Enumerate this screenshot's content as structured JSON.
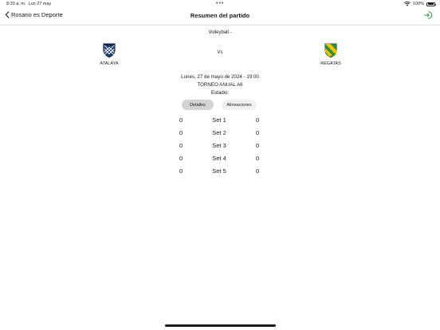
{
  "status_bar": {
    "time": "8:20 a. m.",
    "date": "Lun 27 may",
    "battery": "100%"
  },
  "nav": {
    "back_label": "Rosario es Deporte",
    "title": "Resumen del partido"
  },
  "match": {
    "sport": "Volleyball -",
    "vs": "Vs",
    "home_team": "ATALAYA",
    "away_team": "REGATAS",
    "datetime": "Lunes, 27 de mayo de 2024 - 19:00",
    "tournament": "TORNEO ANUAL A6",
    "stadium": "Estadio:"
  },
  "tabs": {
    "details": "Detalles",
    "lineups": "Alineaciones"
  },
  "sets": [
    {
      "label": "Set 1",
      "home": "0",
      "away": "0"
    },
    {
      "label": "Set 2",
      "home": "0",
      "away": "0"
    },
    {
      "label": "Set 3",
      "home": "0",
      "away": "0"
    },
    {
      "label": "Set 4",
      "home": "0",
      "away": "0"
    },
    {
      "label": "Set 5",
      "home": "0",
      "away": "0"
    }
  ],
  "colors": {
    "accent_green": "#3a9c3f",
    "home_shield": "#1f3d73",
    "away_shield": "#f2c200"
  }
}
